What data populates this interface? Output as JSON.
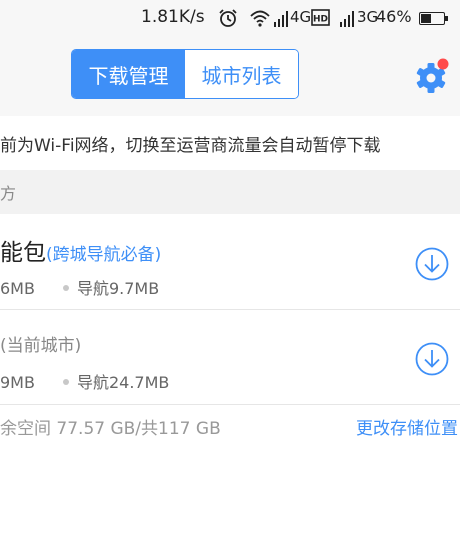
{
  "status_bar": {
    "speed": "1.81K/s",
    "network1": "4G",
    "network2": "3G",
    "battery_percent": "46%",
    "battery_level": 0.46,
    "icons": [
      "alarm-icon",
      "wifi-icon",
      "signal-icon",
      "hd-icon",
      "signal-icon",
      "battery-icon"
    ]
  },
  "header": {
    "tabs": [
      {
        "label": "下载管理",
        "active": true
      },
      {
        "label": "城市列表",
        "active": false
      }
    ],
    "settings_icon": "gear-icon",
    "badge_color": "#ff4b4b"
  },
  "notice": "前为Wi-Fi网络，切换至运营商流量会自动暂停下载",
  "section": {
    "title": "方"
  },
  "items": [
    {
      "title": "能包",
      "tag": "(跨城导航必备)",
      "size_left": "6MB",
      "size_right": "导航9.7MB",
      "action_icon": "download-icon"
    },
    {
      "title": "(当前城市)",
      "tag": "",
      "size_left": "9MB",
      "size_right": "导航24.7MB",
      "action_icon": "download-icon"
    }
  ],
  "footer": {
    "storage": "余空间 77.57 GB/共117 GB",
    "change_storage": "更改存储位置"
  },
  "colors": {
    "accent": "#3e8ff7",
    "header_bg": "#f7f7f7",
    "section_bg": "#f2f2f2"
  }
}
